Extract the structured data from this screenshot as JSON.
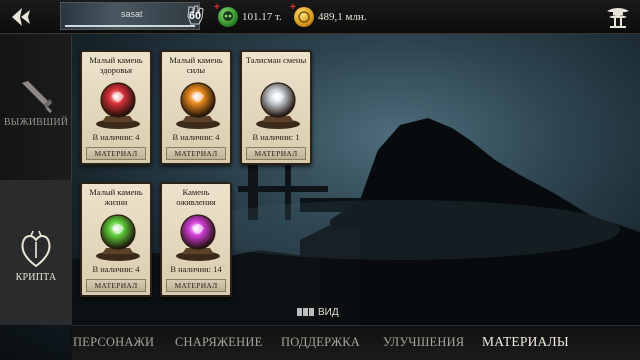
{
  "header": {
    "player_name": "sasat",
    "level": "60",
    "souls": "101.17 т.",
    "koins": "489,1 млн.",
    "plus_sign": "+"
  },
  "sidebar": {
    "items": [
      {
        "label": "ВЫЖИВШИЙ",
        "icon": "dagger-icon"
      },
      {
        "label": "КРИПТА",
        "icon": "krypt-heart-icon"
      }
    ]
  },
  "cards": [
    {
      "title": "Малый камень здоровья",
      "stock": "В наличии: 4",
      "tag": "МАТЕРИАЛ",
      "gem_color": "#d8323a"
    },
    {
      "title": "Малый камень силы",
      "stock": "В наличии: 4",
      "tag": "МАТЕРИАЛ",
      "gem_color": "#e88a1e"
    },
    {
      "title": "Талисман смены",
      "stock": "В наличии: 1",
      "tag": "МАТЕРИАЛ",
      "gem_color": "#c9cfd3"
    },
    {
      "title": "Малый камень жизни",
      "stock": "В наличии: 4",
      "tag": "МАТЕРИАЛ",
      "gem_color": "#5fcf3a"
    },
    {
      "title": "Камень оживления",
      "stock": "В наличии: 14",
      "tag": "МАТЕРИАЛ",
      "gem_color": "#d23ed8"
    }
  ],
  "view_toggle": {
    "label": "ВИД"
  },
  "tabs": [
    {
      "label": "ПЕРСОНАЖИ",
      "active": false
    },
    {
      "label": "СНАРЯЖЕНИЕ",
      "active": false
    },
    {
      "label": "ПОДДЕРЖКА",
      "active": false
    },
    {
      "label": "УЛУЧШЕНИЯ",
      "active": false
    },
    {
      "label": "МАТЕРИАЛЫ",
      "active": true
    }
  ],
  "colors": {
    "souls_green": "#3fae3a",
    "koins_gold": "#e2a51d",
    "card_parchment": "#e6dbc2",
    "plus_red": "#e2332d"
  }
}
